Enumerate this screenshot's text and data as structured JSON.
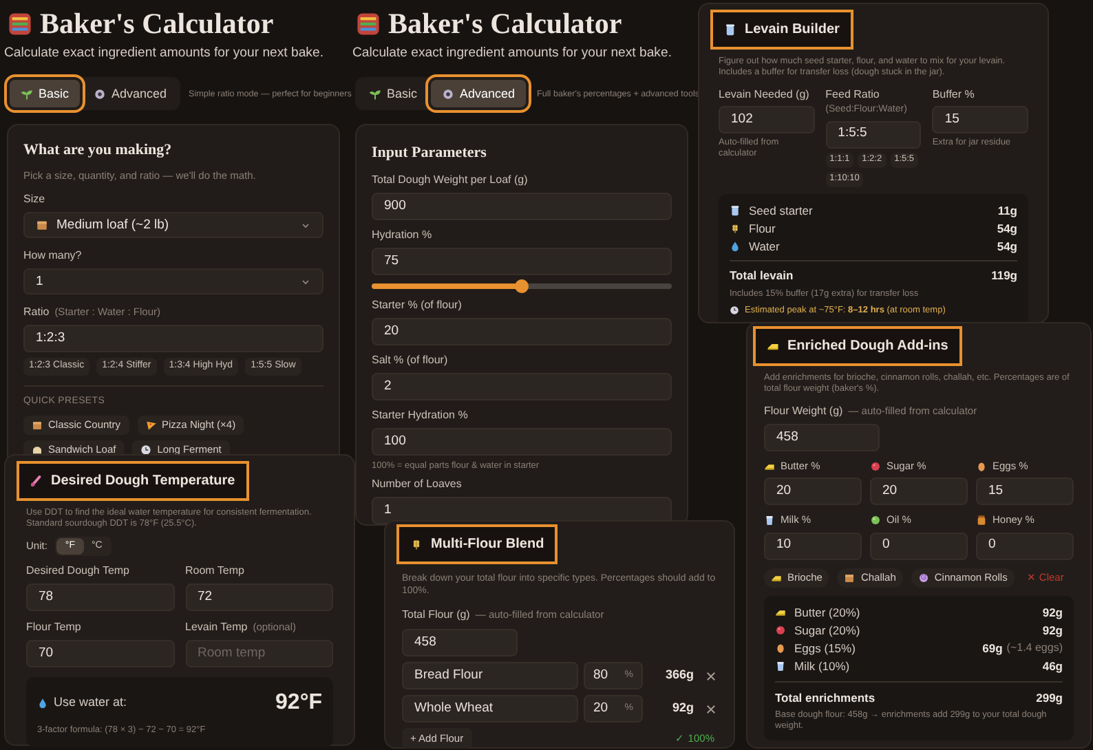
{
  "basic_screen": {
    "title": "Baker's Calculator",
    "subtitle": "Calculate exact ingredient amounts for your next bake.",
    "tabs": [
      {
        "label": "Basic",
        "selected": true,
        "highlighted": true
      },
      {
        "label": "Advanced",
        "selected": false,
        "highlighted": false
      }
    ],
    "mode_hint": "Simple ratio mode — perfect for beginners",
    "card": {
      "heading": "What are you making?",
      "description": "Pick a size, quantity, and ratio — we'll do the math.",
      "size": {
        "label": "Size",
        "value": "Medium loaf (~2 lb)"
      },
      "count": {
        "label": "How many?",
        "value": "1"
      },
      "ratio": {
        "label": "Ratio",
        "hint": "(Starter : Water : Flour)",
        "value": "1:2:3"
      },
      "ratio_presets": [
        "1:2:3 Classic",
        "1:2:4 Stiffer",
        "1:3:4 High Hyd",
        "1:5:5 Slow"
      ],
      "quick_presets_label": "QUICK PRESETS",
      "quick_presets": [
        "Classic Country",
        "Pizza Night (×4)",
        "Sandwich Loaf",
        "Long Ferment"
      ]
    }
  },
  "advanced_screen": {
    "title": "Baker's Calculator",
    "subtitle": "Calculate exact ingredient amounts for your next bake.",
    "tabs": [
      {
        "label": "Basic",
        "selected": false,
        "highlighted": false
      },
      {
        "label": "Advanced",
        "selected": true,
        "highlighted": true
      }
    ],
    "mode_hint": "Full baker's percentages + advanced tools",
    "card": {
      "heading": "Input Parameters",
      "fields": [
        {
          "kind": "input",
          "label": "Total Dough Weight per Loaf (g)",
          "value": "900"
        },
        {
          "kind": "slider",
          "label": "Hydration %",
          "value": "75",
          "level": 0.5
        },
        {
          "kind": "input",
          "label": "Starter % (of flour)",
          "value": "20"
        },
        {
          "kind": "input",
          "label": "Salt % (of flour)",
          "value": "2"
        },
        {
          "kind": "input",
          "label": "Starter Hydration %",
          "value": "100",
          "note": "100% = equal parts flour & water in starter"
        },
        {
          "kind": "input",
          "label": "Number of Loaves",
          "value": "1"
        }
      ]
    }
  },
  "levain_panel": {
    "heading": "Levain Builder",
    "highlighted": true,
    "description": "Figure out how much seed starter, flour, and water to mix for your levain. Includes a buffer for transfer loss (dough stuck in the jar).",
    "fields": [
      {
        "label": "Levain Needed (g)",
        "value": "102",
        "note": "Auto-filled from calculator"
      },
      {
        "label": "Feed Ratio",
        "hint": "(Seed:Flour:Water)",
        "value": "1:5:5",
        "presets": [
          "1:1:1",
          "1:2:2",
          "1:5:5",
          "1:10:10"
        ]
      },
      {
        "label": "Buffer %",
        "value": "15",
        "note": "Extra for jar residue"
      }
    ],
    "results": [
      {
        "name": "Seed starter",
        "amount": "11g"
      },
      {
        "name": "Flour",
        "amount": "54g"
      },
      {
        "name": "Water",
        "amount": "54g"
      }
    ],
    "total": {
      "label": "Total levain",
      "amount": "119g"
    },
    "buffer_note": "Includes 15% buffer (17g extra) for transfer loss",
    "peak_note": "Estimated peak at ~75°F: **8–12 hrs** (at room temp)"
  },
  "ddt_panel": {
    "heading": "Desired Dough Temperature",
    "highlighted": true,
    "description": "Use DDT to find the ideal water temperature for consistent fermentation. Standard sourdough DDT is 78°F (25.5°C).",
    "unit_label": "Unit:",
    "units": [
      {
        "label": "°F",
        "selected": true
      },
      {
        "label": "°C",
        "selected": false
      }
    ],
    "fields": [
      {
        "label": "Desired Dough Temp",
        "value": "78"
      },
      {
        "label": "Room Temp",
        "value": "72"
      },
      {
        "label": "Flour Temp",
        "value": "70"
      },
      {
        "label": "Levain Temp",
        "hint": "(optional)",
        "placeholder": "Room temp"
      }
    ],
    "result": {
      "label": "Use water at:",
      "value": "92°F",
      "formula": "3-factor formula: (78 × 3) − 72 − 70 = 92°F"
    }
  },
  "multi_flour_panel": {
    "heading": "Multi-Flour Blend",
    "highlighted": true,
    "description": "Break down your total flour into specific types. Percentages should add to 100%.",
    "total": {
      "label": "Total Flour (g)",
      "hint": "— auto-filled from calculator",
      "value": "458"
    },
    "flours": [
      {
        "name": "Bread Flour",
        "percent": "80",
        "unit": "%",
        "amount": "366g"
      },
      {
        "name": "Whole Wheat",
        "percent": "20",
        "unit": "%",
        "amount": "92g"
      }
    ],
    "add_button": "+ Add Flour",
    "status": "✓ 100%"
  },
  "enriched_panel": {
    "heading": "Enriched Dough Add-ins",
    "highlighted": true,
    "description": "Add enrichments for brioche, cinnamon rolls, challah, etc. Percentages are of total flour weight (baker's %).",
    "flour_weight": {
      "label": "Flour Weight (g)",
      "hint": "— auto-filled from calculator",
      "value": "458"
    },
    "ingredients": [
      {
        "label": "Butter %",
        "value": "20"
      },
      {
        "label": "Sugar %",
        "value": "20"
      },
      {
        "label": "Eggs %",
        "value": "15"
      },
      {
        "label": "Milk %",
        "value": "10"
      },
      {
        "label": "Oil %",
        "value": "0"
      },
      {
        "label": "Honey %",
        "value": "0"
      }
    ],
    "presets": [
      {
        "kind": "preset",
        "label": "Brioche"
      },
      {
        "kind": "preset",
        "label": "Challah"
      },
      {
        "kind": "preset",
        "label": "Cinnamon Rolls"
      },
      {
        "kind": "clear",
        "label": "✕ Clear"
      }
    ],
    "results": [
      {
        "name": "Butter (20%)",
        "amount": "92g"
      },
      {
        "name": "Sugar (20%)",
        "amount": "92g"
      },
      {
        "name": "Eggs (15%)",
        "amount": "69g",
        "note": "(~1.4 eggs)"
      },
      {
        "name": "Milk (10%)",
        "amount": "46g"
      }
    ],
    "total": {
      "label": "Total enrichments",
      "amount": "299g"
    },
    "summary": "Base dough flour: 458g → enrichments add 299g to your total dough weight."
  }
}
